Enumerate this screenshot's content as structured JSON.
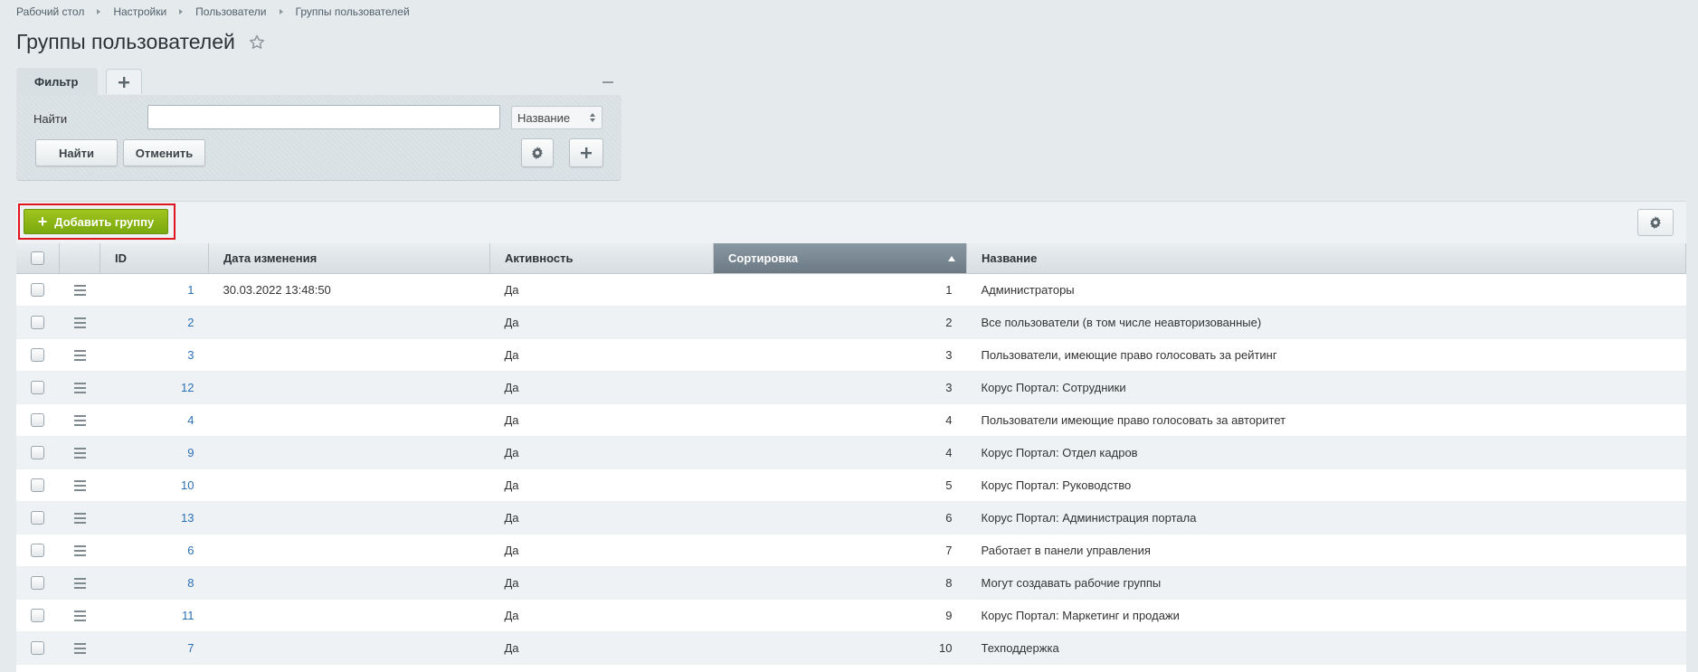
{
  "breadcrumb": [
    "Рабочий стол",
    "Настройки",
    "Пользователи",
    "Группы пользователей"
  ],
  "page_title": "Группы пользователей",
  "filter": {
    "tab_label": "Фильтр",
    "find_label": "Найти",
    "input_value": "",
    "field_select": "Название",
    "find_button": "Найти",
    "cancel_button": "Отменить"
  },
  "toolbar": {
    "add_button": "Добавить группу"
  },
  "columns": [
    "ID",
    "Дата изменения",
    "Активность",
    "Сортировка",
    "Название"
  ],
  "rows": [
    {
      "id": "1",
      "date": "30.03.2022 13:48:50",
      "active": "Да",
      "sort": "1",
      "name": "Администраторы"
    },
    {
      "id": "2",
      "date": "",
      "active": "Да",
      "sort": "2",
      "name": "Все пользователи (в том числе неавторизованные)"
    },
    {
      "id": "3",
      "date": "",
      "active": "Да",
      "sort": "3",
      "name": "Пользователи, имеющие право голосовать за рейтинг"
    },
    {
      "id": "12",
      "date": "",
      "active": "Да",
      "sort": "3",
      "name": "Корус Портал: Сотрудники"
    },
    {
      "id": "4",
      "date": "",
      "active": "Да",
      "sort": "4",
      "name": "Пользователи имеющие право голосовать за авторитет"
    },
    {
      "id": "9",
      "date": "",
      "active": "Да",
      "sort": "4",
      "name": "Корус Портал: Отдел кадров"
    },
    {
      "id": "10",
      "date": "",
      "active": "Да",
      "sort": "5",
      "name": "Корус Портал: Руководство"
    },
    {
      "id": "13",
      "date": "",
      "active": "Да",
      "sort": "6",
      "name": "Корус Портал: Администрация портала"
    },
    {
      "id": "6",
      "date": "",
      "active": "Да",
      "sort": "7",
      "name": "Работает в панели управления"
    },
    {
      "id": "8",
      "date": "",
      "active": "Да",
      "sort": "8",
      "name": "Могут создавать рабочие группы"
    },
    {
      "id": "11",
      "date": "",
      "active": "Да",
      "sort": "9",
      "name": "Корус Портал: Маркетинг и продажи"
    },
    {
      "id": "7",
      "date": "",
      "active": "Да",
      "sort": "10",
      "name": "Техподдержка"
    }
  ],
  "colors": {
    "accent_green": "#8ab616",
    "highlight_red": "#e0151e",
    "link_blue": "#2c6fb5"
  }
}
